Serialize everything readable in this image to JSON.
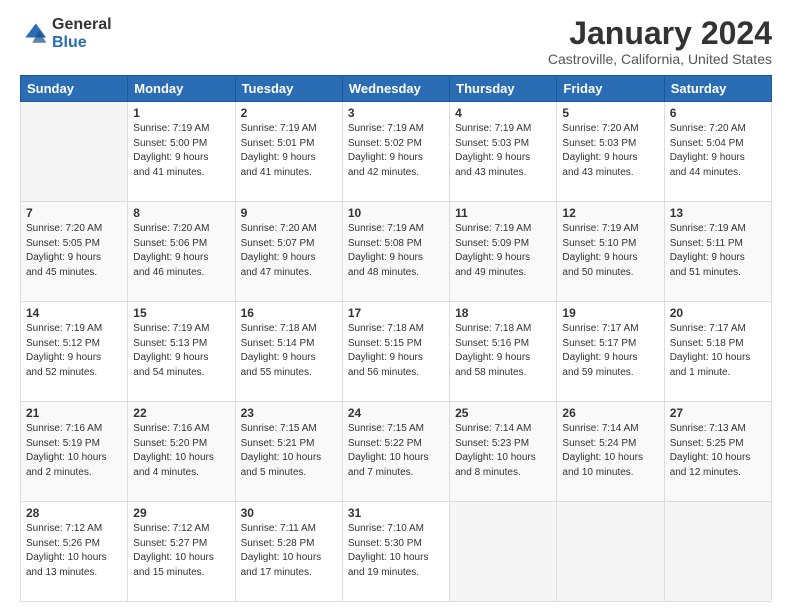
{
  "logo": {
    "general": "General",
    "blue": "Blue"
  },
  "header": {
    "title": "January 2024",
    "subtitle": "Castroville, California, United States"
  },
  "weekdays": [
    "Sunday",
    "Monday",
    "Tuesday",
    "Wednesday",
    "Thursday",
    "Friday",
    "Saturday"
  ],
  "weeks": [
    [
      {
        "day": "",
        "detail": ""
      },
      {
        "day": "1",
        "detail": "Sunrise: 7:19 AM\nSunset: 5:00 PM\nDaylight: 9 hours\nand 41 minutes."
      },
      {
        "day": "2",
        "detail": "Sunrise: 7:19 AM\nSunset: 5:01 PM\nDaylight: 9 hours\nand 41 minutes."
      },
      {
        "day": "3",
        "detail": "Sunrise: 7:19 AM\nSunset: 5:02 PM\nDaylight: 9 hours\nand 42 minutes."
      },
      {
        "day": "4",
        "detail": "Sunrise: 7:19 AM\nSunset: 5:03 PM\nDaylight: 9 hours\nand 43 minutes."
      },
      {
        "day": "5",
        "detail": "Sunrise: 7:20 AM\nSunset: 5:03 PM\nDaylight: 9 hours\nand 43 minutes."
      },
      {
        "day": "6",
        "detail": "Sunrise: 7:20 AM\nSunset: 5:04 PM\nDaylight: 9 hours\nand 44 minutes."
      }
    ],
    [
      {
        "day": "7",
        "detail": "Sunrise: 7:20 AM\nSunset: 5:05 PM\nDaylight: 9 hours\nand 45 minutes."
      },
      {
        "day": "8",
        "detail": "Sunrise: 7:20 AM\nSunset: 5:06 PM\nDaylight: 9 hours\nand 46 minutes."
      },
      {
        "day": "9",
        "detail": "Sunrise: 7:20 AM\nSunset: 5:07 PM\nDaylight: 9 hours\nand 47 minutes."
      },
      {
        "day": "10",
        "detail": "Sunrise: 7:19 AM\nSunset: 5:08 PM\nDaylight: 9 hours\nand 48 minutes."
      },
      {
        "day": "11",
        "detail": "Sunrise: 7:19 AM\nSunset: 5:09 PM\nDaylight: 9 hours\nand 49 minutes."
      },
      {
        "day": "12",
        "detail": "Sunrise: 7:19 AM\nSunset: 5:10 PM\nDaylight: 9 hours\nand 50 minutes."
      },
      {
        "day": "13",
        "detail": "Sunrise: 7:19 AM\nSunset: 5:11 PM\nDaylight: 9 hours\nand 51 minutes."
      }
    ],
    [
      {
        "day": "14",
        "detail": "Sunrise: 7:19 AM\nSunset: 5:12 PM\nDaylight: 9 hours\nand 52 minutes."
      },
      {
        "day": "15",
        "detail": "Sunrise: 7:19 AM\nSunset: 5:13 PM\nDaylight: 9 hours\nand 54 minutes."
      },
      {
        "day": "16",
        "detail": "Sunrise: 7:18 AM\nSunset: 5:14 PM\nDaylight: 9 hours\nand 55 minutes."
      },
      {
        "day": "17",
        "detail": "Sunrise: 7:18 AM\nSunset: 5:15 PM\nDaylight: 9 hours\nand 56 minutes."
      },
      {
        "day": "18",
        "detail": "Sunrise: 7:18 AM\nSunset: 5:16 PM\nDaylight: 9 hours\nand 58 minutes."
      },
      {
        "day": "19",
        "detail": "Sunrise: 7:17 AM\nSunset: 5:17 PM\nDaylight: 9 hours\nand 59 minutes."
      },
      {
        "day": "20",
        "detail": "Sunrise: 7:17 AM\nSunset: 5:18 PM\nDaylight: 10 hours\nand 1 minute."
      }
    ],
    [
      {
        "day": "21",
        "detail": "Sunrise: 7:16 AM\nSunset: 5:19 PM\nDaylight: 10 hours\nand 2 minutes."
      },
      {
        "day": "22",
        "detail": "Sunrise: 7:16 AM\nSunset: 5:20 PM\nDaylight: 10 hours\nand 4 minutes."
      },
      {
        "day": "23",
        "detail": "Sunrise: 7:15 AM\nSunset: 5:21 PM\nDaylight: 10 hours\nand 5 minutes."
      },
      {
        "day": "24",
        "detail": "Sunrise: 7:15 AM\nSunset: 5:22 PM\nDaylight: 10 hours\nand 7 minutes."
      },
      {
        "day": "25",
        "detail": "Sunrise: 7:14 AM\nSunset: 5:23 PM\nDaylight: 10 hours\nand 8 minutes."
      },
      {
        "day": "26",
        "detail": "Sunrise: 7:14 AM\nSunset: 5:24 PM\nDaylight: 10 hours\nand 10 minutes."
      },
      {
        "day": "27",
        "detail": "Sunrise: 7:13 AM\nSunset: 5:25 PM\nDaylight: 10 hours\nand 12 minutes."
      }
    ],
    [
      {
        "day": "28",
        "detail": "Sunrise: 7:12 AM\nSunset: 5:26 PM\nDaylight: 10 hours\nand 13 minutes."
      },
      {
        "day": "29",
        "detail": "Sunrise: 7:12 AM\nSunset: 5:27 PM\nDaylight: 10 hours\nand 15 minutes."
      },
      {
        "day": "30",
        "detail": "Sunrise: 7:11 AM\nSunset: 5:28 PM\nDaylight: 10 hours\nand 17 minutes."
      },
      {
        "day": "31",
        "detail": "Sunrise: 7:10 AM\nSunset: 5:30 PM\nDaylight: 10 hours\nand 19 minutes."
      },
      {
        "day": "",
        "detail": ""
      },
      {
        "day": "",
        "detail": ""
      },
      {
        "day": "",
        "detail": ""
      }
    ]
  ]
}
